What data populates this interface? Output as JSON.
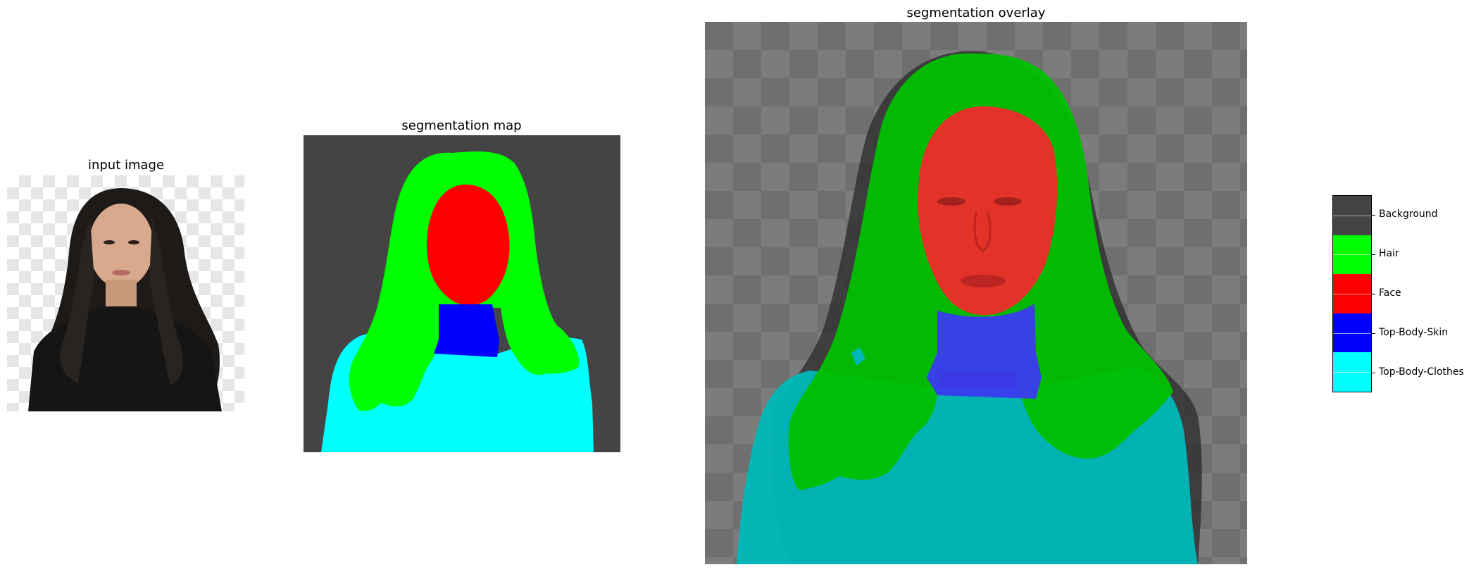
{
  "panels": {
    "input_title": "input image",
    "map_title": "segmentation map",
    "overlay_title": "segmentation overlay"
  },
  "legend": {
    "items": [
      {
        "label": "Background",
        "color": "#444444"
      },
      {
        "label": "Hair",
        "color": "#00ff00"
      },
      {
        "label": "Face",
        "color": "#ff0000"
      },
      {
        "label": "Top-Body-Skin",
        "color": "#0000ff"
      },
      {
        "label": "Top-Body-Clothes",
        "color": "#00ffff"
      }
    ]
  },
  "colors": {
    "background": "#444444",
    "hair": "#00ff00",
    "face": "#ff0000",
    "skin": "#0000ff",
    "clothes": "#00ffff"
  }
}
